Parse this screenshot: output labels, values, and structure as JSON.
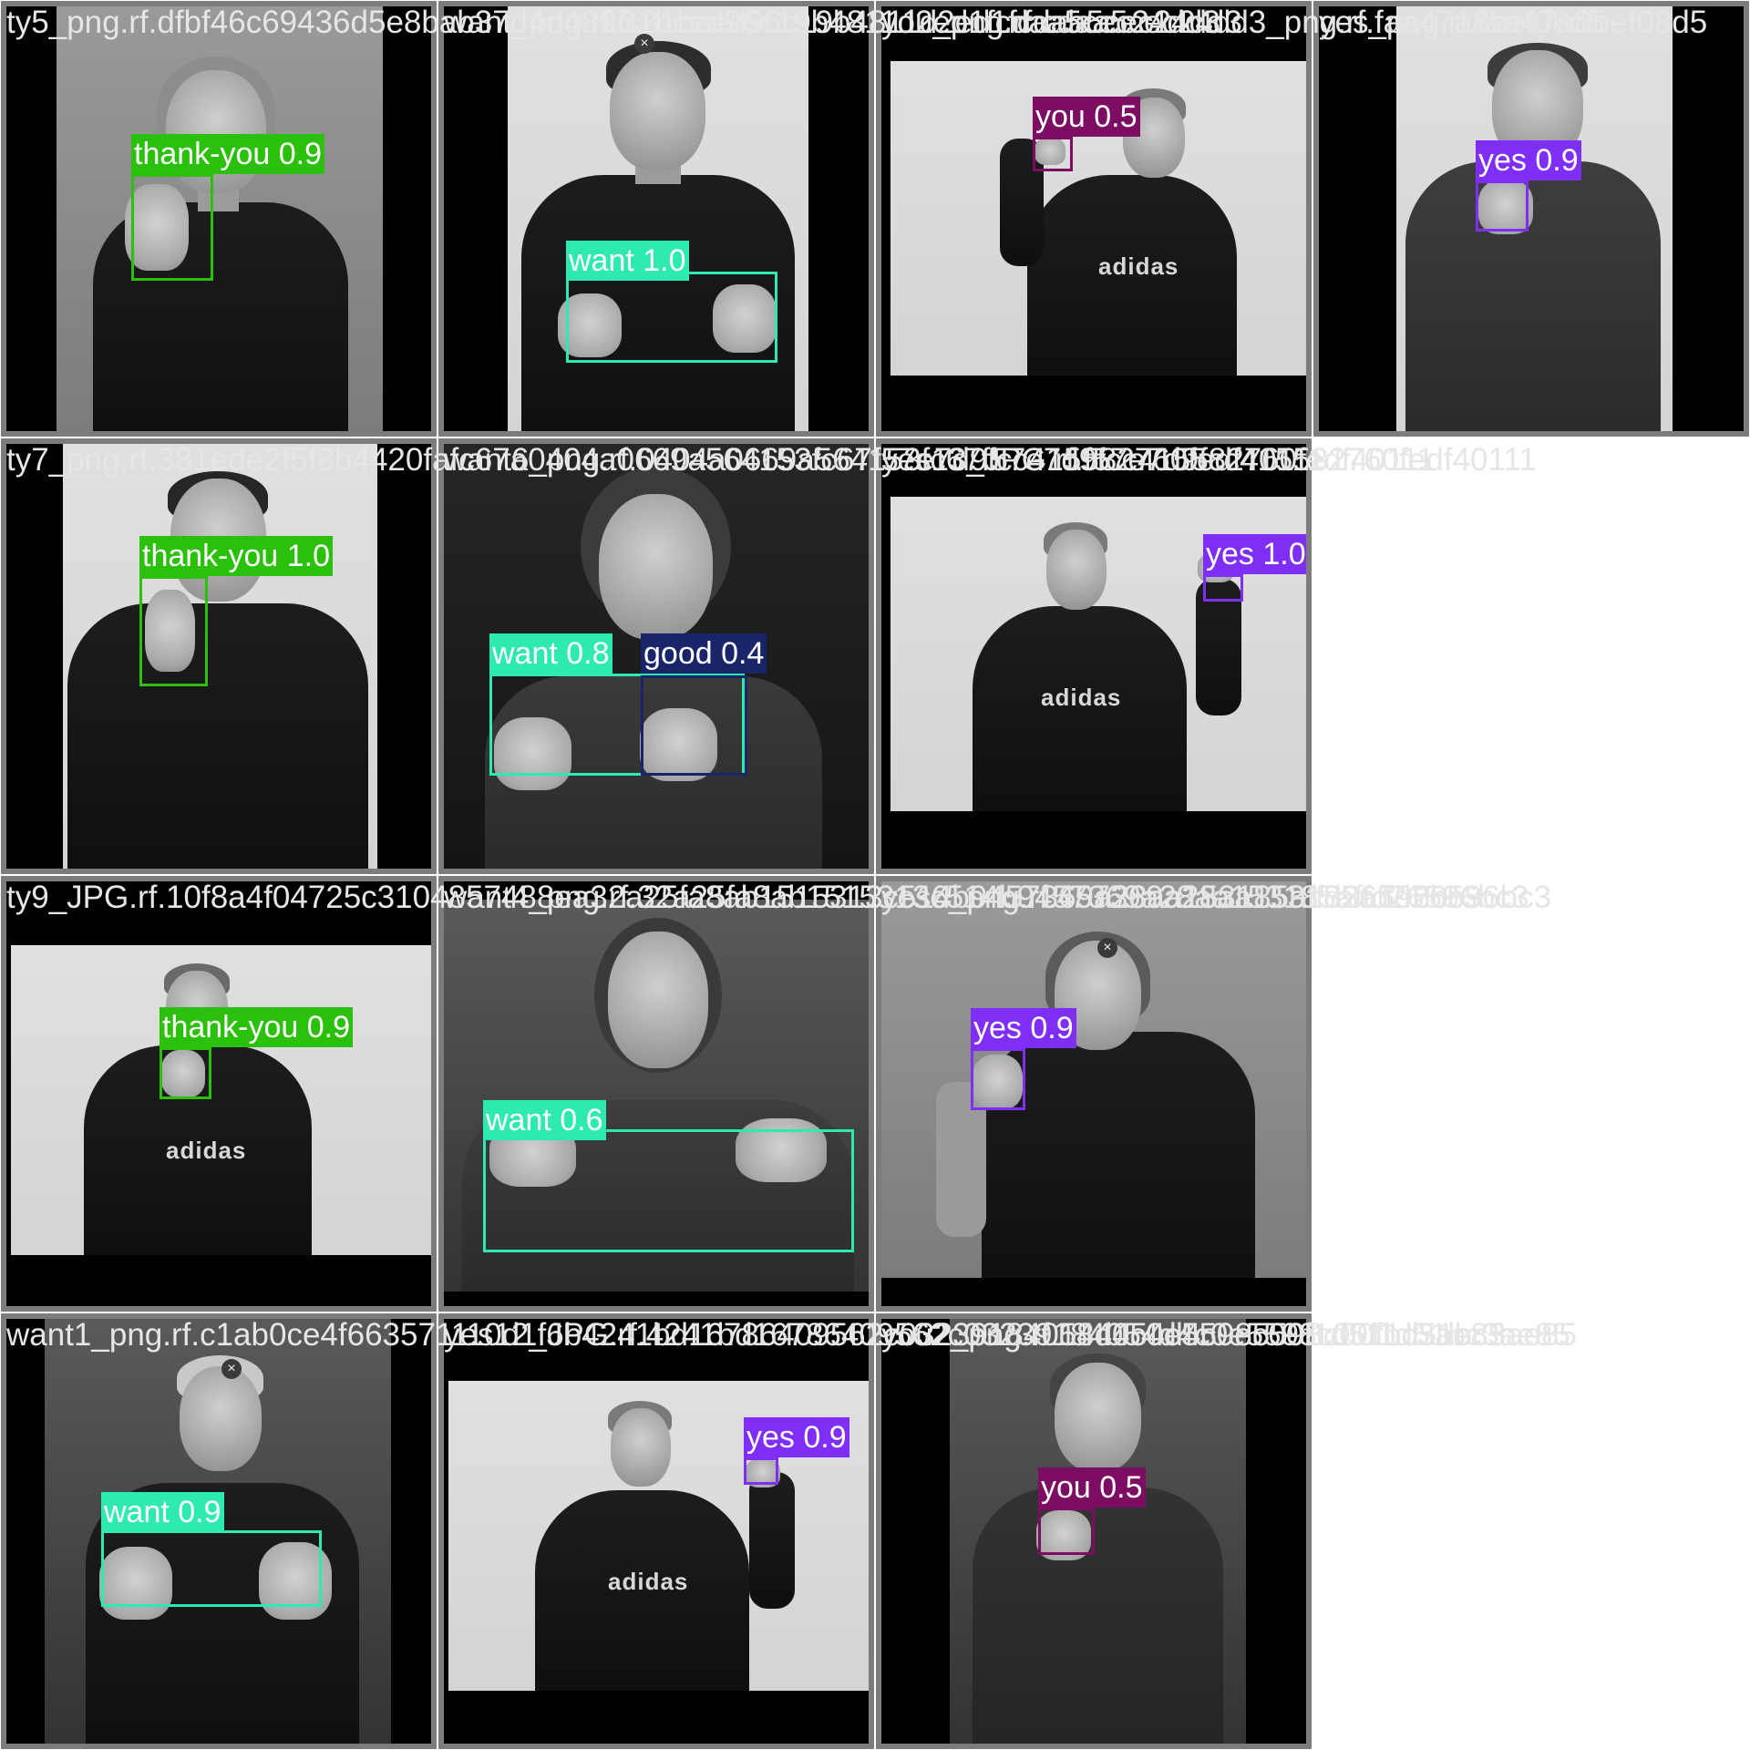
{
  "colors": {
    "thank-you": "#2ac00b",
    "want": "#2eeab1",
    "you": "#7c0d63",
    "yes": "#7f2ef5",
    "good": "#192469"
  },
  "tiles": [
    {
      "filename": "ty5_png.rf.dfbf46c69436d5e8bab37d4d489fc31bced96c19b4811d2ed1fcdaa5cec24dd3",
      "labels": [
        {
          "text": "thank-you 0.9",
          "cls": "thank-you"
        }
      ]
    },
    {
      "filename": "want_png.rf.31bced96c19b4811d2ed1fcdaa5cec24dd3",
      "labels": [
        {
          "text": "want 1.0",
          "cls": "want"
        }
      ]
    },
    {
      "filename": "you_png.rf.cdaa5cec24dd3_png.rf.faa47a8bef08d5",
      "labels": [
        {
          "text": "you 0.5",
          "cls": "you"
        }
      ]
    },
    {
      "filename": "yes_png.rf.faa47a8bef08d5",
      "labels": [
        {
          "text": "yes 0.9",
          "cls": "yes"
        }
      ]
    },
    {
      "filename": "ty7_png.rf.381ede2f5f8b4420fafc67a0404a0669a564153fc67f57e7d9fcc415582760fedf40111",
      "labels": [
        {
          "text": "thank-you 1.0",
          "cls": "thank-you"
        }
      ]
    },
    {
      "filename": "want6_png.rf.0404a0669a564153fc67f57e7d9fcc415582760fedf40111",
      "labels": [
        {
          "text": "want 0.8",
          "cls": "want"
        },
        {
          "text": "good 0.4",
          "cls": "good"
        }
      ]
    },
    {
      "filename": "yes13_JPG.rf.f57e7d9fcc415582760fedf40111",
      "labels": [
        {
          "text": "yes 1.0",
          "cls": "yes"
        }
      ]
    },
    {
      "filename": "ty9_JPG.rf.10f8a4f04725c3104857488ea32a25fa8ab1515313c514b9457369a28aa153185affd26596bc3",
      "labels": [
        {
          "text": "thank-you 0.9",
          "cls": "thank-you"
        }
      ]
    },
    {
      "filename": "want4_png.rf.32a25fa8ab1515313c514b9457369a28aa153185affd26596bc3",
      "labels": [
        {
          "text": "want 0.6",
          "cls": "want"
        }
      ]
    },
    {
      "filename": "yes6_png.rf.457369a28aa153185affd26596bc3",
      "labels": [
        {
          "text": "yes 0.9",
          "cls": "yes"
        }
      ]
    },
    {
      "filename": "want1_png.rf.c1ab0ce4f663571110d1f6b4241bd16786409562c03239184054d4c0e5598c00f1d51bc3ae85",
      "labels": [
        {
          "text": "want 0.9",
          "cls": "want"
        }
      ]
    },
    {
      "filename": "yes12_JPG.rf.4241bd16786409562c03239184054d4c0e5598c00f1d51bc3ae85",
      "labels": [
        {
          "text": "yes 0.9",
          "cls": "yes"
        }
      ]
    },
    {
      "filename": "you2_png.rf.184054d4c0e5598c00f1d51bc3ae85",
      "labels": [
        {
          "text": "you 0.5",
          "cls": "you"
        }
      ]
    }
  ],
  "shirt_logo": "adidas",
  "close_glyph": "×"
}
